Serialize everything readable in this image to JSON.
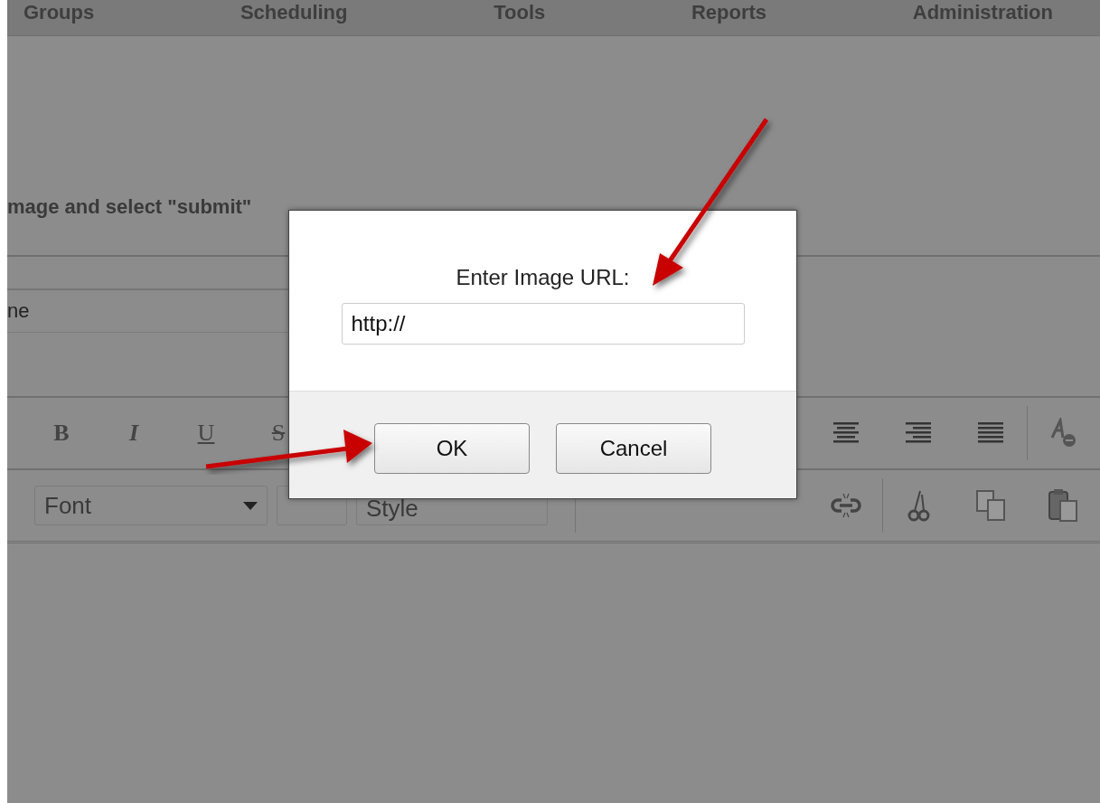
{
  "nav": {
    "items": [
      "Groups",
      "Scheduling",
      "Tools",
      "Reports",
      "Administration"
    ]
  },
  "instruction": "mage and select \"submit\"",
  "field": {
    "value": "ne"
  },
  "toolbar": {
    "format_buttons": [
      {
        "label": "B",
        "kind": "bold"
      },
      {
        "label": "I",
        "kind": "italic"
      },
      {
        "label": "U",
        "kind": "underline"
      },
      {
        "label": "S",
        "kind": "strike"
      }
    ],
    "font_select": {
      "value": "Font"
    },
    "style_select": {
      "value": "Style"
    }
  },
  "dialog": {
    "label": "Enter Image URL:",
    "url_field": {
      "value": "http://"
    },
    "buttons": [
      "OK",
      "Cancel"
    ]
  }
}
